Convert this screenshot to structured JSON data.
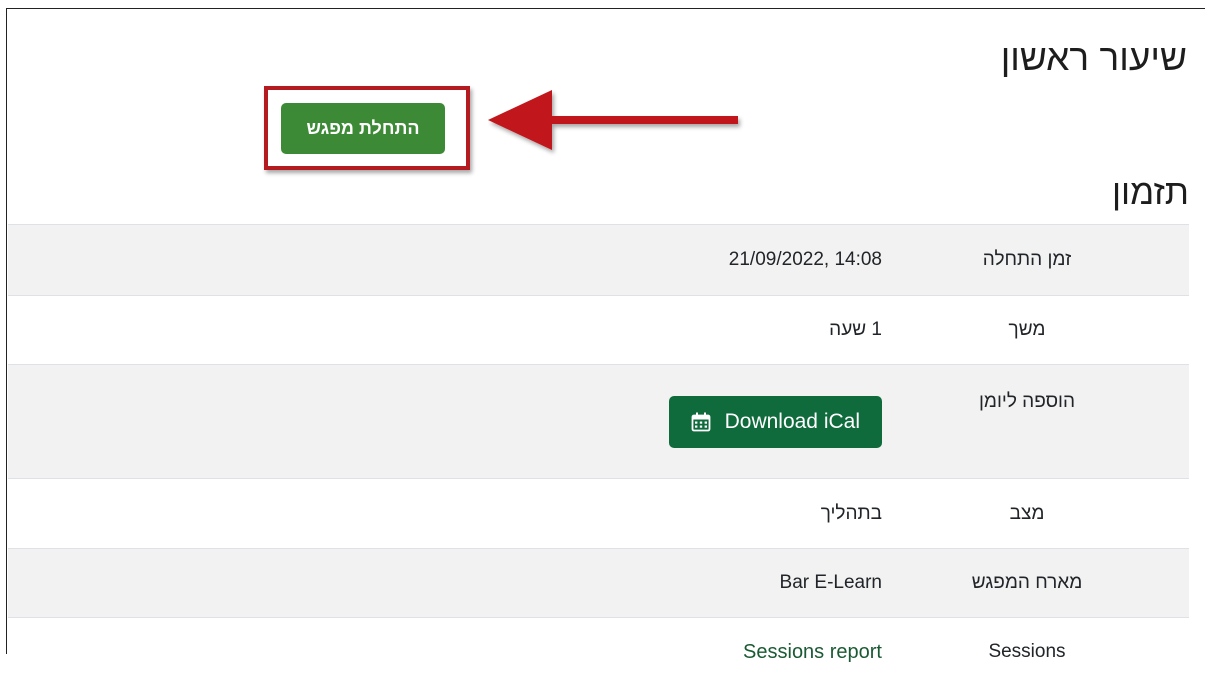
{
  "page": {
    "title": "שיעור ראשון",
    "start_button_label": "התחלת מפגש",
    "section_title": "תזמון"
  },
  "annotation": {
    "box_color": "#b31b20",
    "arrow_color": "#c0141b"
  },
  "colors": {
    "start_button": "#3d8a36",
    "ical_button": "#0f6b3c"
  },
  "details": {
    "start_time": {
      "label": "זמן התחלה",
      "value": "21/09/2022, 14:08"
    },
    "duration": {
      "label": "משך",
      "value": "1 שעה"
    },
    "calendar": {
      "label": "הוספה ליומן",
      "button_label": "Download iCal",
      "icon": "calendar-icon"
    },
    "status": {
      "label": "מצב",
      "value": "בתהליך"
    },
    "host": {
      "label": "מארח המפגש",
      "value": "Bar E-Learn"
    },
    "sessions": {
      "label": "Sessions",
      "link_label": "Sessions report"
    }
  }
}
